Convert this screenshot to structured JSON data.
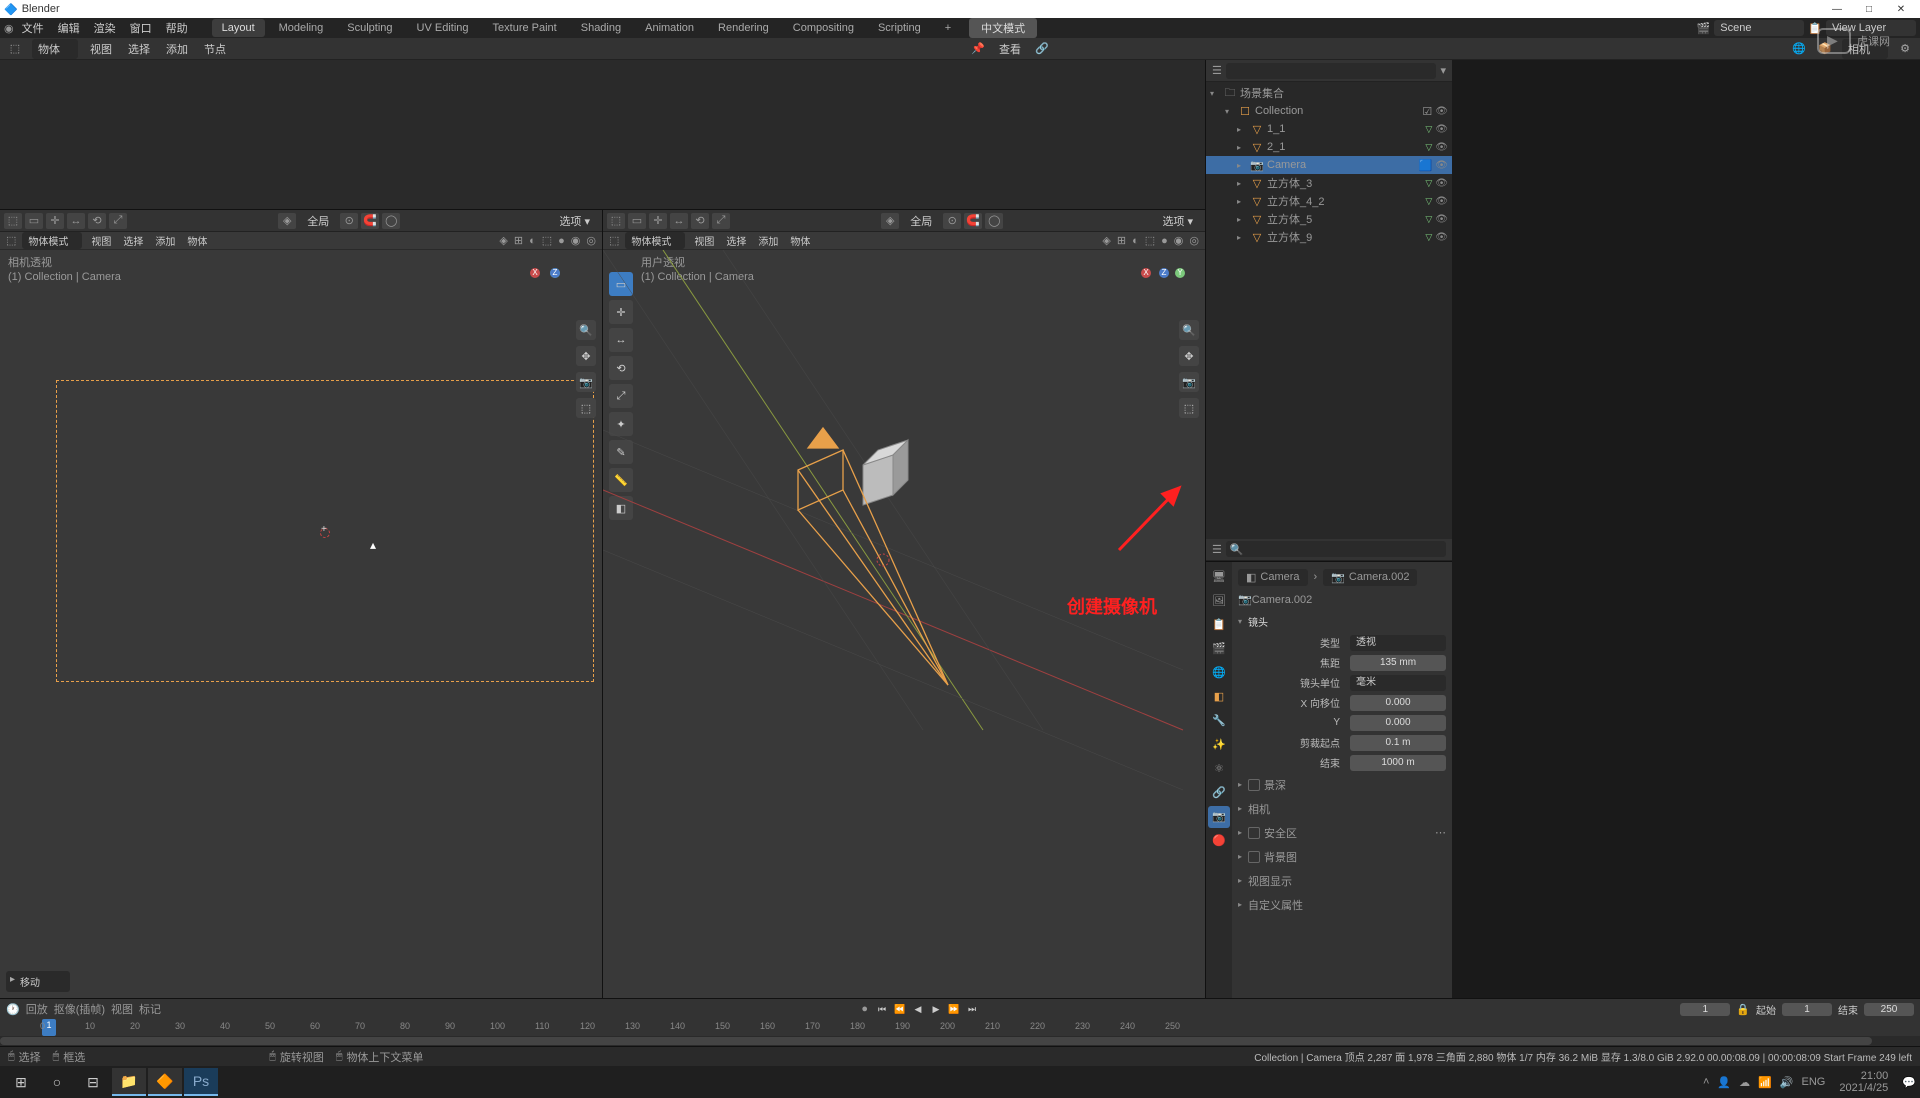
{
  "app": {
    "title": "Blender"
  },
  "win_controls": {
    "min": "—",
    "max": "□",
    "close": "✕"
  },
  "topmenu": {
    "items": [
      "文件",
      "编辑",
      "渲染",
      "窗口",
      "帮助"
    ],
    "tabs": [
      "Layout",
      "Modeling",
      "Sculpting",
      "UV Editing",
      "Texture Paint",
      "Shading",
      "Animation",
      "Rendering",
      "Compositing",
      "Scripting"
    ],
    "active_tab": 0,
    "add_tab": "+",
    "lang_btn": "中文模式",
    "scene_lbl": "Scene",
    "viewlayer_lbl": "View Layer"
  },
  "subheader": {
    "mode": "物体",
    "menus": [
      "视图",
      "选择",
      "添加",
      "节点"
    ],
    "right_search": "查看",
    "right_menu": "相机"
  },
  "vp_left": {
    "header_mode": "全局",
    "subheader_mode": "物体模式",
    "sub_menus": [
      "视图",
      "选择",
      "添加",
      "物体"
    ],
    "info_title": "相机透视",
    "info_sub": "(1) Collection | Camera",
    "collapse_label": "移动"
  },
  "vp_right": {
    "header_mode": "全局",
    "subheader_mode": "物体模式",
    "sub_menus": [
      "视图",
      "选择",
      "添加",
      "物体"
    ],
    "info_title": "用户透视",
    "info_sub": "(1) Collection | Camera",
    "annotation": "创建摄像机"
  },
  "outliner": {
    "root": "场景集合",
    "items": [
      {
        "name": "Collection",
        "indent": 1,
        "type": "collection"
      },
      {
        "name": "1_1",
        "indent": 2,
        "type": "empty"
      },
      {
        "name": "2_1",
        "indent": 2,
        "type": "empty"
      },
      {
        "name": "Camera",
        "indent": 2,
        "type": "camera",
        "selected": true
      },
      {
        "name": "立方体_3",
        "indent": 2,
        "type": "mesh"
      },
      {
        "name": "立方体_4_2",
        "indent": 2,
        "type": "mesh"
      },
      {
        "name": "立方体_5",
        "indent": 2,
        "type": "mesh"
      },
      {
        "name": "立方体_9",
        "indent": 2,
        "type": "mesh"
      }
    ]
  },
  "props": {
    "breadcrumb1": "Camera",
    "breadcrumb2": "Camera.002",
    "name_field": "Camera.002",
    "section_lens": "镜头",
    "type_lbl": "类型",
    "type_val": "透视",
    "focal_lbl": "焦距",
    "focal_val": "135 mm",
    "unit_lbl": "镜头单位",
    "unit_val": "毫米",
    "shift_x_lbl": "X 向移位",
    "shift_x_val": "0.000",
    "shift_y_lbl": "Y",
    "shift_y_val": "0.000",
    "clip_start_lbl": "剪裁起点",
    "clip_start_val": "0.1 m",
    "clip_end_lbl": "结束",
    "clip_end_val": "1000 m",
    "sections": [
      "景深",
      "相机",
      "安全区",
      "背景图",
      "视图显示",
      "自定义属性"
    ]
  },
  "timeline": {
    "menus": [
      "回放",
      "抠像(插帧)",
      "视图",
      "标记"
    ],
    "current": "1",
    "start_lbl": "起始",
    "start_val": "1",
    "end_lbl": "结束",
    "end_val": "250",
    "ticks": [
      0,
      10,
      20,
      30,
      40,
      50,
      60,
      70,
      80,
      90,
      100,
      110,
      120,
      130,
      140,
      150,
      160,
      170,
      180,
      190,
      200,
      210,
      220,
      230,
      240,
      250
    ],
    "cursor_frame": "1"
  },
  "statusbar": {
    "left1": "选择",
    "left2": "框选",
    "mid1": "旋转视图",
    "mid2": "物体上下文菜单",
    "right": "Collection | Camera     顶点 2,287    面 1,978    三角面 2,880    物体 1/7    内存 36.2 MiB    显存 1.3/8.0 GiB    2.92.0    00.00:08.09   |   00:00:08:09     Start Frame 249 left"
  },
  "taskbar": {
    "time": "21:00",
    "date": "2021/4/25",
    "lang": "ENG"
  },
  "watermark": "虎课网",
  "chart_data": null
}
